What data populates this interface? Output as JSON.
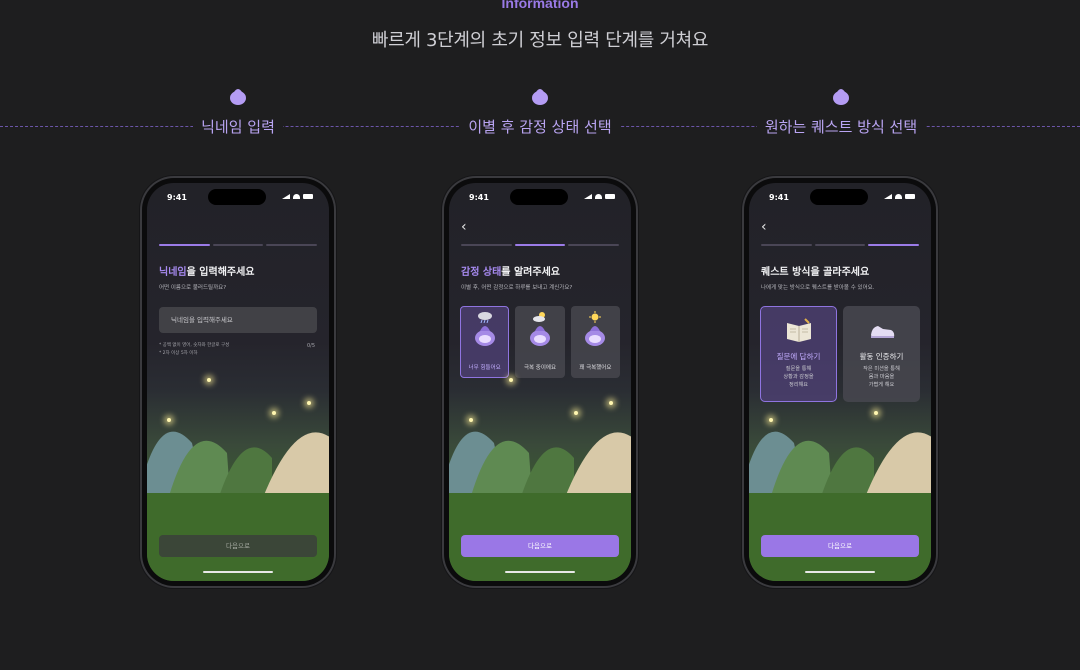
{
  "header": {
    "kicker": "Information",
    "subtitle": "빠르게 3단계의 초기 정보 입력 단계를 거쳐요"
  },
  "steps": [
    {
      "label": "닉네임 입력"
    },
    {
      "label": "이별 후 감정 상태 선택"
    },
    {
      "label": "원하는 퀘스트 방식 선택"
    }
  ],
  "status_time": "9:41",
  "phone1": {
    "progress": [
      true,
      false,
      false
    ],
    "title_highlight": "닉네임",
    "title_rest": "을 입력해주세요",
    "subtitle": "어떤 이름으로 불러드릴까요?",
    "input_placeholder": "닉네임을 입력해주세요",
    "hint1": "* 공백 없이 영어, 숫자와 한글로 구성",
    "hint2": "* 2자 이상 5자 이하",
    "counter": "0/5",
    "cta": "다음으로",
    "cta_enabled": false
  },
  "phone2": {
    "progress": [
      false,
      true,
      false
    ],
    "title_highlight": "감정 상태",
    "title_rest": "를 알려주세요",
    "subtitle": "이별 후, 어떤 감정으로 하루를 보내고 계신가요?",
    "cards": [
      {
        "label": "너무 힘들어요",
        "weather": "rain-cloud-icon",
        "selected": true
      },
      {
        "label": "극복 중이에요",
        "weather": "sun-behind-cloud-icon",
        "selected": false
      },
      {
        "label": "꽤 극복했어요",
        "weather": "sun-icon",
        "selected": false
      }
    ],
    "cta": "다음으로",
    "cta_enabled": true
  },
  "phone3": {
    "progress": [
      false,
      false,
      true
    ],
    "title": "퀘스트 방식을 골라주세요",
    "subtitle": "나에게 맞는 방식으로 퀘스트를 받아볼 수 있어요.",
    "cards": [
      {
        "title": "질문에 답하기",
        "desc": "질문을 통해\n상황과 감정을\n정리해요",
        "icon": "book-icon",
        "selected": true
      },
      {
        "title": "활동 인증하기",
        "desc": "작은 미션을 통해\n몸과 마음을\n가볍게 해요",
        "icon": "sneaker-icon",
        "selected": false
      }
    ],
    "cta": "다음으로",
    "cta_enabled": true
  },
  "colors": {
    "accent": "#9a77e6",
    "background": "#1e1e1f",
    "highlight_text": "#a78af0"
  }
}
